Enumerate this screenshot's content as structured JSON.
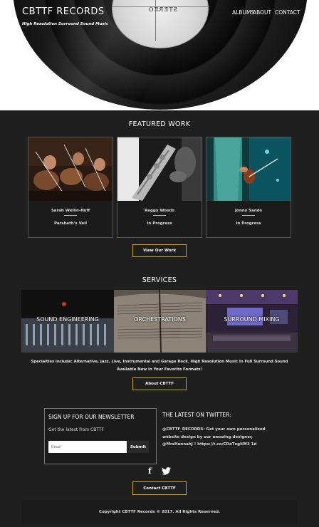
{
  "header": {
    "brand": "CBTTF RECORDS",
    "tagline": "High Resolution Surround Sound Music",
    "nav": [
      "ALBUMS",
      "ABOUT",
      "CONTACT"
    ],
    "record_label_text": "STEREO"
  },
  "featured": {
    "title": "FEATURED WORK",
    "cards": [
      {
        "name": "Sarah Wellin-Huff",
        "status": "Parsheth's Veil"
      },
      {
        "name": "Reggy Woods",
        "status": "In Progress"
      },
      {
        "name": "Jonny Sands",
        "status": "In Progress"
      }
    ],
    "button": "View Our Work"
  },
  "services": {
    "title": "SERVICES",
    "items": [
      "SOUND ENGINEERING",
      "ORCHESTRATIONS",
      "SURROUND MIXING"
    ],
    "specialities": "Specialties include: Alternative, Jazz, Live, Instrumental and Garage Rock. High Resolution Music In Full Surround Sound Available Now In Your Favorite Formats!",
    "button": "About CBTTF"
  },
  "newsletter": {
    "title": "SIGN UP FOR OUR NEWSLETTER",
    "subtitle": "Get the latest from CBTTF",
    "placeholder": "Email",
    "submit": "Submit"
  },
  "twitter": {
    "title": "THE LATEST ON TWITTER:",
    "tweet": "@CBTTF_RECORDS: Get your own personalized website design by our amazing designer, @MrsHannahJ ! https://t.co/CDoTxgliW3 1d"
  },
  "social": {
    "facebook": "f",
    "twitter_icon": "twitter-bird-icon"
  },
  "contact_button": "Contact CBTTF",
  "footer": {
    "copyright": "Copyright CBTTF Records © 2017. All Rights Reserved."
  },
  "colors": {
    "accent": "#c9a227",
    "background": "#1f1f1f"
  }
}
